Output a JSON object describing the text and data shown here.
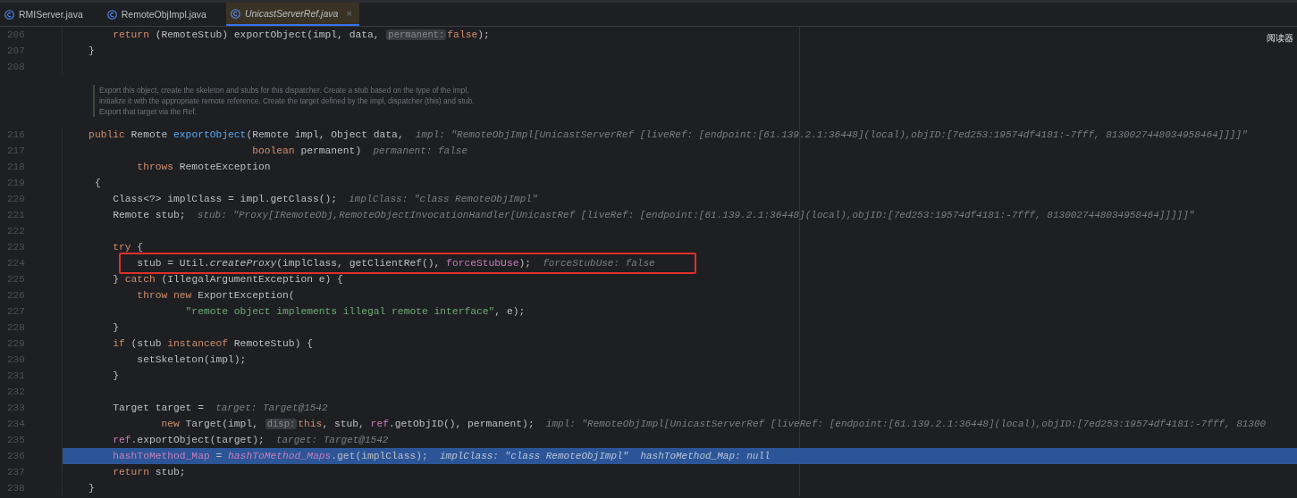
{
  "tabs": [
    {
      "label": "RMIServer.java",
      "selected": false
    },
    {
      "label": "RemoteObjImpl.java",
      "selected": false
    },
    {
      "label": "UnicastServerRef.java",
      "selected": true,
      "close": "×"
    }
  ],
  "overlay_text": "阅读器",
  "lines": [
    {
      "kind": "code",
      "number": "206",
      "selected": false,
      "annotated": false,
      "segments": [
        {
          "kind": "code",
          "tokens": [
            {
              "kind": "kw",
              "text": "        return "
            },
            {
              "kind": "plain",
              "text": "(RemoteStub) exportObject(impl, data, "
            }
          ]
        },
        {
          "kind": "param",
          "text": "permanent:"
        },
        {
          "kind": "code",
          "tokens": [
            {
              "kind": "kw",
              "text": "false"
            },
            {
              "kind": "plain",
              "text": ");"
            }
          ]
        }
      ]
    },
    {
      "kind": "code",
      "number": "207",
      "selected": false,
      "annotated": false,
      "segments": [
        {
          "kind": "code",
          "tokens": [
            {
              "kind": "plain",
              "text": "    }"
            }
          ]
        }
      ]
    },
    {
      "kind": "code",
      "number": "208",
      "selected": false,
      "annotated": false
    },
    {
      "kind": "doc",
      "text": "Export this object, create the skeleton and stubs for this dispatcher. Create a stub based on the type of the impl, initialize it with the appropriate remote reference. Create the target defined by the impl, dispatcher (this) and stub. Export that target via the Ref."
    },
    {
      "kind": "code",
      "number": "216",
      "selected": false,
      "annotated": false,
      "segments": [
        {
          "kind": "code",
          "tokens": [
            {
              "kind": "kw",
              "text": "    public "
            },
            {
              "kind": "plain",
              "text": "Remote "
            },
            {
              "kind": "fn",
              "text": "exportObject"
            },
            {
              "kind": "plain",
              "text": "(Remote impl, Object data,"
            }
          ]
        },
        {
          "kind": "hint",
          "text": "impl: \"RemoteObjImpl[UnicastServerRef [liveRef: [endpoint:[61.139.2.1:36448](local),objID:[7ed253:19574df4181:-7fff, 8130027448034958464]]]]\""
        }
      ]
    },
    {
      "kind": "code",
      "number": "217",
      "selected": false,
      "annotated": false,
      "segments": [
        {
          "kind": "code",
          "tokens": [
            {
              "kind": "kw",
              "text": "                               boolean "
            },
            {
              "kind": "plain",
              "text": "permanent)"
            }
          ]
        },
        {
          "kind": "hint",
          "text": "permanent: false"
        }
      ]
    },
    {
      "kind": "code",
      "number": "218",
      "selected": false,
      "annotated": false,
      "segments": [
        {
          "kind": "code",
          "tokens": [
            {
              "kind": "kw",
              "text": "            throws "
            },
            {
              "kind": "plain",
              "text": "RemoteException"
            }
          ]
        }
      ]
    },
    {
      "kind": "code",
      "number": "219",
      "selected": false,
      "annotated": false,
      "segments": [
        {
          "kind": "code",
          "tokens": [
            {
              "kind": "plain",
              "text": "     {"
            }
          ]
        }
      ]
    },
    {
      "kind": "code",
      "number": "220",
      "selected": false,
      "annotated": false,
      "segments": [
        {
          "kind": "code",
          "tokens": [
            {
              "kind": "plain",
              "text": "        Class<?> implClass = impl.getClass();"
            }
          ]
        },
        {
          "kind": "hint",
          "text": "implClass: \"class RemoteObjImpl\""
        }
      ]
    },
    {
      "kind": "code",
      "number": "221",
      "selected": false,
      "annotated": false,
      "segments": [
        {
          "kind": "code",
          "tokens": [
            {
              "kind": "plain",
              "text": "        Remote stub;"
            }
          ]
        },
        {
          "kind": "hint",
          "text": "stub: \"Proxy[IRemoteObj,RemoteObjectInvocationHandler[UnicastRef [liveRef: [endpoint:[61.139.2.1:36448](local),objID:[7ed253:19574df4181:-7fff, 8130027448034958464]]]]]\""
        }
      ]
    },
    {
      "kind": "code",
      "number": "222",
      "selected": false,
      "annotated": false
    },
    {
      "kind": "code",
      "number": "223",
      "selected": false,
      "annotated": false,
      "segments": [
        {
          "kind": "code",
          "tokens": [
            {
              "kind": "kw",
              "text": "        try "
            },
            {
              "kind": "plain",
              "text": "{"
            }
          ]
        }
      ]
    },
    {
      "kind": "code",
      "number": "224",
      "selected": false,
      "annotated": true,
      "segments": [
        {
          "kind": "code",
          "tokens": [
            {
              "kind": "plain",
              "text": "            stub = Util."
            },
            {
              "kind": "static",
              "text": "createProxy"
            },
            {
              "kind": "plain",
              "text": "(implClass, getClientRef(), "
            },
            {
              "kind": "field",
              "text": "forceStubUse"
            },
            {
              "kind": "plain",
              "text": ");"
            }
          ]
        },
        {
          "kind": "hint",
          "text": "forceStubUse: false"
        }
      ]
    },
    {
      "kind": "code",
      "number": "225",
      "selected": false,
      "annotated": false,
      "segments": [
        {
          "kind": "code",
          "tokens": [
            {
              "kind": "plain",
              "text": "        } "
            },
            {
              "kind": "kw",
              "text": "catch "
            },
            {
              "kind": "plain",
              "text": "(IllegalArgumentException e) {"
            }
          ]
        }
      ]
    },
    {
      "kind": "code",
      "number": "226",
      "selected": false,
      "annotated": false,
      "segments": [
        {
          "kind": "code",
          "tokens": [
            {
              "kind": "kw",
              "text": "            throw new "
            },
            {
              "kind": "plain",
              "text": "ExportException("
            }
          ]
        }
      ]
    },
    {
      "kind": "code",
      "number": "227",
      "selected": false,
      "annotated": false,
      "segments": [
        {
          "kind": "code",
          "tokens": [
            {
              "kind": "str",
              "text": "                    \"remote object implements illegal remote interface\""
            },
            {
              "kind": "plain",
              "text": ", e);"
            }
          ]
        }
      ]
    },
    {
      "kind": "code",
      "number": "228",
      "selected": false,
      "annotated": false,
      "segments": [
        {
          "kind": "code",
          "tokens": [
            {
              "kind": "plain",
              "text": "        }"
            }
          ]
        }
      ]
    },
    {
      "kind": "code",
      "number": "229",
      "selected": false,
      "annotated": false,
      "segments": [
        {
          "kind": "code",
          "tokens": [
            {
              "kind": "kw",
              "text": "        if "
            },
            {
              "kind": "plain",
              "text": "(stub "
            },
            {
              "kind": "kw",
              "text": "instanceof "
            },
            {
              "kind": "plain",
              "text": "RemoteStub) {"
            }
          ]
        }
      ]
    },
    {
      "kind": "code",
      "number": "230",
      "selected": false,
      "annotated": false,
      "segments": [
        {
          "kind": "code",
          "tokens": [
            {
              "kind": "plain",
              "text": "            setSkeleton(impl);"
            }
          ]
        }
      ]
    },
    {
      "kind": "code",
      "number": "231",
      "selected": false,
      "annotated": false,
      "segments": [
        {
          "kind": "code",
          "tokens": [
            {
              "kind": "plain",
              "text": "        }"
            }
          ]
        }
      ]
    },
    {
      "kind": "code",
      "number": "232",
      "selected": false,
      "annotated": false
    },
    {
      "kind": "code",
      "number": "233",
      "selected": false,
      "annotated": false,
      "segments": [
        {
          "kind": "code",
          "tokens": [
            {
              "kind": "plain",
              "text": "        Target target ="
            }
          ]
        },
        {
          "kind": "hint",
          "text": "target: Target@1542"
        }
      ]
    },
    {
      "kind": "code",
      "number": "234",
      "selected": false,
      "annotated": false,
      "segments": [
        {
          "kind": "code",
          "tokens": [
            {
              "kind": "kw",
              "text": "                new "
            },
            {
              "kind": "plain",
              "text": "Target(impl, "
            }
          ]
        },
        {
          "kind": "param",
          "text": "disp:"
        },
        {
          "kind": "code",
          "tokens": [
            {
              "kind": "kw",
              "text": "this"
            },
            {
              "kind": "plain",
              "text": ", stub, "
            },
            {
              "kind": "field",
              "text": "ref"
            },
            {
              "kind": "plain",
              "text": ".getObjID(), permanent);"
            }
          ]
        },
        {
          "kind": "hint",
          "text": "impl: \"RemoteObjImpl[UnicastServerRef [liveRef: [endpoint:[61.139.2.1:36448](local),objID:[7ed253:19574df4181:-7fff, 81300"
        }
      ]
    },
    {
      "kind": "code",
      "number": "235",
      "selected": false,
      "annotated": false,
      "segments": [
        {
          "kind": "code",
          "tokens": [
            {
              "kind": "field",
              "text": "        ref"
            },
            {
              "kind": "plain",
              "text": ".exportObject(target);"
            }
          ]
        },
        {
          "kind": "hint",
          "text": "target: Target@1542"
        }
      ]
    },
    {
      "kind": "code",
      "number": "236",
      "selected": true,
      "annotated": false,
      "segments": [
        {
          "kind": "code",
          "tokens": [
            {
              "kind": "field",
              "text": "        hashToMethod_Map"
            },
            {
              "kind": "plain",
              "text": " = "
            },
            {
              "kind": "staticfield",
              "text": "hashToMethod_Maps"
            },
            {
              "kind": "plain",
              "text": ".get(implClass);"
            }
          ]
        },
        {
          "kind": "hint",
          "text": "implClass: \"class RemoteObjImpl\""
        },
        {
          "kind": "hint",
          "text": "hashToMethod_Map: null"
        }
      ]
    },
    {
      "kind": "code",
      "number": "237",
      "selected": false,
      "annotated": false,
      "segments": [
        {
          "kind": "code",
          "tokens": [
            {
              "kind": "kw",
              "text": "        return "
            },
            {
              "kind": "plain",
              "text": "stub;"
            }
          ]
        }
      ]
    },
    {
      "kind": "code",
      "number": "238",
      "selected": false,
      "annotated": false,
      "segments": [
        {
          "kind": "code",
          "tokens": [
            {
              "kind": "plain",
              "text": "    }"
            }
          ]
        }
      ]
    }
  ]
}
